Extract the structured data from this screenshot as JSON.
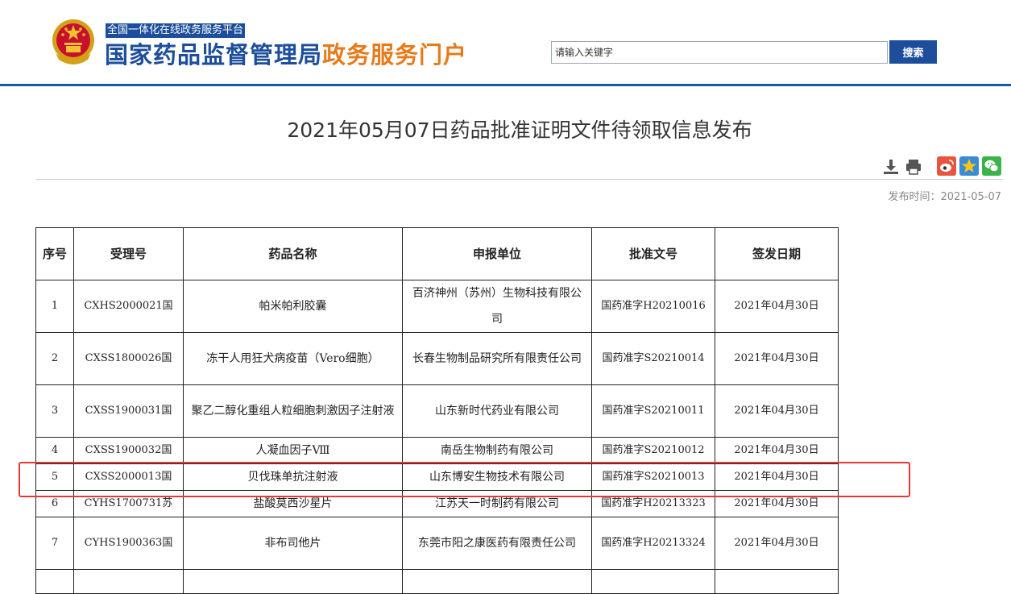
{
  "header": {
    "platform_tag": "全国一体化在线政务服务平台",
    "title_main": "国家药品监督管理局",
    "title_accent": "政务服务门户",
    "search_placeholder": "请输入关键字",
    "search_button": "搜索",
    "colors": {
      "brand_blue": "#1d4e9c",
      "accent_orange": "#e77b1b"
    }
  },
  "article": {
    "title": "2021年05月07日药品批准证明文件待领取信息发布",
    "publish_time": "发布时间：2021-05-07",
    "tools": [
      "download-icon",
      "print-icon",
      "weibo-icon",
      "favorite-icon",
      "wechat-icon"
    ]
  },
  "table": {
    "headers": [
      "序号",
      "受理号",
      "药品名称",
      "申报单位",
      "批准文号",
      "签发日期"
    ],
    "rows": [
      {
        "no": "1",
        "accept_no": "CXHS2000021国",
        "drug": "帕米帕利胶囊",
        "applicant": "百济神州（苏州）生物科技有限公司",
        "approval": "国药准字H20210016",
        "date": "2021年04月30日"
      },
      {
        "no": "2",
        "accept_no": "CXSS1800026国",
        "drug": "冻干人用狂犬病疫苗（Vero细胞）",
        "applicant": "长春生物制品研究所有限责任公司",
        "approval": "国药准字S20210014",
        "date": "2021年04月30日"
      },
      {
        "no": "3",
        "accept_no": "CXSS1900031国",
        "drug": "聚乙二醇化重组人粒细胞刺激因子注射液",
        "applicant": "山东新时代药业有限公司",
        "approval": "国药准字S20210011",
        "date": "2021年04月30日"
      },
      {
        "no": "4",
        "accept_no": "CXSS1900032国",
        "drug": "人凝血因子Ⅷ",
        "applicant": "南岳生物制药有限公司",
        "approval": "国药准字S20210012",
        "date": "2021年04月30日"
      },
      {
        "no": "5",
        "accept_no": "CXSS2000013国",
        "drug": "贝伐珠单抗注射液",
        "applicant": "山东博安生物技术有限公司",
        "approval": "国药准字S20210013",
        "date": "2021年04月30日"
      },
      {
        "no": "6",
        "accept_no": "CYHS1700731苏",
        "drug": "盐酸莫西沙星片",
        "applicant": "江苏天一时制药有限公司",
        "approval": "国药准字H20213323",
        "date": "2021年04月30日"
      },
      {
        "no": "7",
        "accept_no": "CYHS1900363国",
        "drug": "非布司他片",
        "applicant": "东莞市阳之康医药有限责任公司",
        "approval": "国药准字H20213324",
        "date": "2021年04月30日"
      }
    ],
    "highlight_color": "#e53935"
  }
}
